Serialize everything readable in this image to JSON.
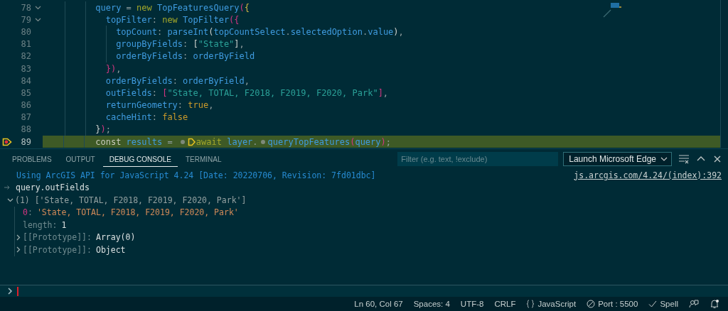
{
  "editor": {
    "lines": [
      {
        "number": "78",
        "foldable": true,
        "current": false,
        "tokens": [
          {
            "kind": "id",
            "text": "          query"
          },
          {
            "kind": "punc",
            "text": " = "
          },
          {
            "kind": "kw",
            "text": "new "
          },
          {
            "kind": "id",
            "text": "TopFeaturesQuery"
          },
          {
            "kind": "b1",
            "text": "("
          },
          {
            "kind": "b2",
            "text": "{"
          }
        ]
      },
      {
        "number": "79",
        "foldable": true,
        "current": false,
        "tokens": [
          {
            "kind": "id",
            "text": "            topFilter"
          },
          {
            "kind": "punc",
            "text": ": "
          },
          {
            "kind": "kw",
            "text": "new "
          },
          {
            "kind": "id",
            "text": "TopFilter"
          },
          {
            "kind": "b1",
            "text": "("
          },
          {
            "kind": "b1",
            "text": "{"
          }
        ]
      },
      {
        "number": "80",
        "foldable": false,
        "current": false,
        "tokens": [
          {
            "kind": "id",
            "text": "              topCount"
          },
          {
            "kind": "punc",
            "text": ": "
          },
          {
            "kind": "id",
            "text": "parseInt"
          },
          {
            "kind": "b3",
            "text": "("
          },
          {
            "kind": "id",
            "text": "topCountSelect"
          },
          {
            "kind": "punc",
            "text": "."
          },
          {
            "kind": "id",
            "text": "selectedOption"
          },
          {
            "kind": "punc",
            "text": "."
          },
          {
            "kind": "id",
            "text": "value"
          },
          {
            "kind": "b3",
            "text": ")"
          },
          {
            "kind": "punc",
            "text": ","
          }
        ]
      },
      {
        "number": "81",
        "foldable": false,
        "current": false,
        "tokens": [
          {
            "kind": "id",
            "text": "              groupByFields"
          },
          {
            "kind": "punc",
            "text": ": "
          },
          {
            "kind": "b3",
            "text": "["
          },
          {
            "kind": "str",
            "text": "\"State\""
          },
          {
            "kind": "b3",
            "text": "]"
          },
          {
            "kind": "punc",
            "text": ","
          }
        ]
      },
      {
        "number": "82",
        "foldable": false,
        "current": false,
        "tokens": [
          {
            "kind": "id",
            "text": "              orderByFields"
          },
          {
            "kind": "punc",
            "text": ": "
          },
          {
            "kind": "id",
            "text": "orderByField"
          }
        ]
      },
      {
        "number": "83",
        "foldable": false,
        "current": false,
        "tokens": [
          {
            "kind": "b1",
            "text": "            }"
          },
          {
            "kind": "b1",
            "text": ")"
          },
          {
            "kind": "punc",
            "text": ","
          }
        ]
      },
      {
        "number": "84",
        "foldable": false,
        "current": false,
        "tokens": [
          {
            "kind": "id",
            "text": "            orderByFields"
          },
          {
            "kind": "punc",
            "text": ": "
          },
          {
            "kind": "id",
            "text": "orderByField"
          },
          {
            "kind": "punc",
            "text": ","
          }
        ]
      },
      {
        "number": "85",
        "foldable": false,
        "current": false,
        "tokens": [
          {
            "kind": "id",
            "text": "            outFields"
          },
          {
            "kind": "punc",
            "text": ": "
          },
          {
            "kind": "b1",
            "text": "["
          },
          {
            "kind": "str",
            "text": "\"State, TOTAL, F2018, F2019, F2020, Park\""
          },
          {
            "kind": "b1",
            "text": "]"
          },
          {
            "kind": "punc",
            "text": ","
          }
        ]
      },
      {
        "number": "86",
        "foldable": false,
        "current": false,
        "tokens": [
          {
            "kind": "id",
            "text": "            returnGeometry"
          },
          {
            "kind": "punc",
            "text": ": "
          },
          {
            "kind": "bool",
            "text": "true"
          },
          {
            "kind": "punc",
            "text": ","
          }
        ]
      },
      {
        "number": "87",
        "foldable": false,
        "current": false,
        "tokens": [
          {
            "kind": "id",
            "text": "            cacheHint"
          },
          {
            "kind": "punc",
            "text": ": "
          },
          {
            "kind": "bool",
            "text": "false"
          }
        ]
      },
      {
        "number": "88",
        "foldable": false,
        "current": false,
        "tokens": [
          {
            "kind": "b3",
            "text": "          }"
          },
          {
            "kind": "b1",
            "text": ")"
          },
          {
            "kind": "punc",
            "text": ";"
          }
        ]
      },
      {
        "number": "89",
        "foldable": false,
        "current": true,
        "tokens": [
          {
            "kind": "decl",
            "text": "          const "
          },
          {
            "kind": "id",
            "text": "results"
          },
          {
            "kind": "punc",
            "text": " = "
          },
          {
            "kind": "inline_breakpoint"
          },
          {
            "kind": "paused_breakpoint"
          },
          {
            "kind": "kw",
            "text": "await "
          },
          {
            "kind": "id",
            "text": "layer"
          },
          {
            "kind": "punc",
            "text": "."
          },
          {
            "kind": "inline_breakpoint"
          },
          {
            "kind": "id",
            "text": "queryTopFeatures"
          },
          {
            "kind": "b1",
            "text": "("
          },
          {
            "kind": "id",
            "text": "query"
          },
          {
            "kind": "b1",
            "text": ")"
          },
          {
            "kind": "punc",
            "text": ";"
          }
        ]
      }
    ]
  },
  "panel": {
    "tabs": [
      {
        "label": "PROBLEMS",
        "selected": false
      },
      {
        "label": "OUTPUT",
        "selected": false
      },
      {
        "label": "DEBUG CONSOLE",
        "selected": true
      },
      {
        "label": "TERMINAL",
        "selected": false
      }
    ],
    "filter": {
      "placeholder": "Filter (e.g. text, !exclude)"
    },
    "launch_config": "Launch Microsoft Edge",
    "console": [
      {
        "kind": "info",
        "text": "Using ArcGIS API for JavaScript 4.24 [Date: 20220706, Revision: 7fd01dbc]",
        "source": "js.arcgis.com/4.24/(index):392"
      },
      {
        "kind": "input",
        "text": "query.outFields"
      },
      {
        "kind": "array",
        "text": "(1) ['State, TOTAL, F2018, F2019, F2020, Park']",
        "expanded": true,
        "children": [
          {
            "kind": "index",
            "key": "0",
            "separator": ":",
            "value": "'State, TOTAL, F2018, F2019, F2020, Park'"
          },
          {
            "kind": "prop",
            "key": "length",
            "separator": ":",
            "value": "1"
          },
          {
            "kind": "object",
            "key": "[[Prototype]]",
            "separator": ":",
            "value": "Array(0)",
            "expanded": false
          },
          {
            "kind": "object",
            "key": "[[Prototype]]",
            "separator": ":",
            "value": "Object",
            "expanded": false
          }
        ]
      }
    ]
  },
  "status_bar": [
    {
      "kind": "plain",
      "text": "Ln 60, Col 67"
    },
    {
      "kind": "plain",
      "text": "Spaces: 4"
    },
    {
      "kind": "plain",
      "text": "UTF-8"
    },
    {
      "kind": "plain",
      "text": "CRLF"
    },
    {
      "kind": "language",
      "text": "JavaScript"
    },
    {
      "kind": "port",
      "text": "Port : 5500"
    },
    {
      "kind": "spell",
      "text": "Spell"
    },
    {
      "kind": "feedback"
    },
    {
      "kind": "notifications"
    }
  ]
}
